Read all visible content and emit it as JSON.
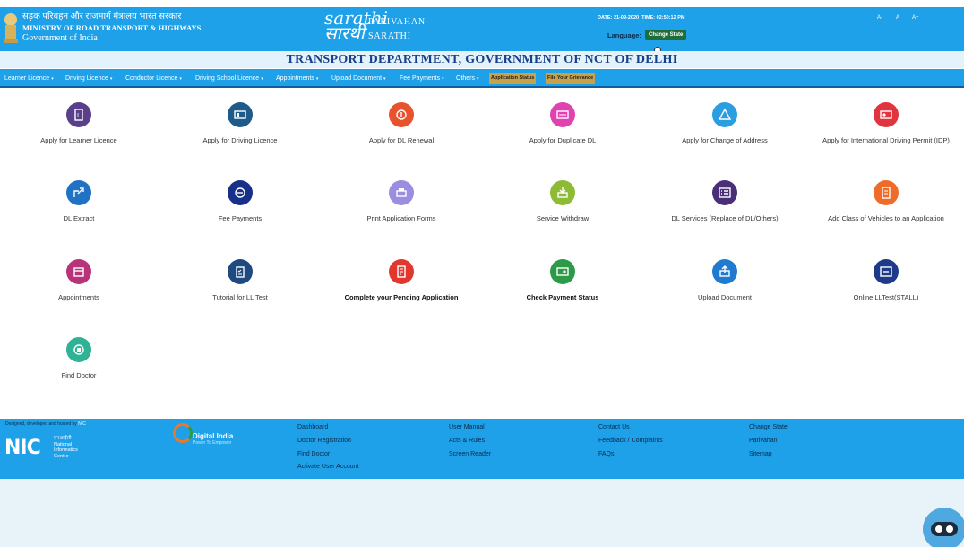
{
  "header": {
    "ministry_hindi": "सड़क परिवहन और राजमार्ग मंत्रालय भारत सरकार",
    "ministry_english": "MINISTRY OF ROAD TRANSPORT & HIGHWAYS",
    "government": "Government of India",
    "logo_mark": "sarathi",
    "logo_hindi": "सारथी",
    "logo_line1": "PARIVAHAN",
    "logo_line2": "SARATHI",
    "date_label": "DATE:",
    "date_value": "21-09-2020",
    "time_label": "TIME:",
    "time_value": "02:50:12 PM",
    "font_small": "A-",
    "font_normal": "A",
    "font_large": "A+",
    "language_label": "Language:",
    "change_state_label": "Change State"
  },
  "department_title": "TRANSPORT DEPARTMENT, GOVERNMENT OF NCT OF DELHI",
  "nav": {
    "items": [
      "Learner Licence",
      "Driving Licence",
      "Conductor Licence",
      "Driving School Licence",
      "Appointments",
      "Upload Document",
      "Fee Payments",
      "Others"
    ],
    "caret": "▾",
    "application_status": "Application Status",
    "file_grievance": "File Your Grievance"
  },
  "services": [
    {
      "label": "Apply for Learner Licence",
      "color": "#5a3f8a",
      "icon": "learner-licence-icon"
    },
    {
      "label": "Apply for Driving Licence",
      "color": "#1f5b8a",
      "icon": "driving-licence-icon"
    },
    {
      "label": "Apply for DL Renewal",
      "color": "#e8532e",
      "icon": "dl-renewal-icon"
    },
    {
      "label": "Apply for Duplicate DL",
      "color": "#e043b0",
      "icon": "duplicate-dl-icon"
    },
    {
      "label": "Apply for Change of Address",
      "color": "#2a9ee0",
      "icon": "change-address-icon"
    },
    {
      "label": "Apply for International Driving Permit (IDP)",
      "color": "#e0343f",
      "icon": "idp-icon"
    },
    {
      "label": "DL Extract",
      "color": "#1f72c4",
      "icon": "dl-extract-icon"
    },
    {
      "label": "Fee Payments",
      "color": "#17308a",
      "icon": "fee-payments-icon"
    },
    {
      "label": "Print Application Forms",
      "color": "#9b8ee0",
      "icon": "print-forms-icon"
    },
    {
      "label": "Service Withdraw",
      "color": "#8dbb35",
      "icon": "service-withdraw-icon"
    },
    {
      "label": "DL Services (Replace of DL/Others)",
      "color": "#4a2f78",
      "icon": "dl-services-icon"
    },
    {
      "label": "Add Class of Vehicles to an Application",
      "color": "#ee6b2a",
      "icon": "add-vehicle-class-icon"
    },
    {
      "label": "Appointments",
      "color": "#b8337a",
      "icon": "appointments-icon"
    },
    {
      "label": "Tutorial for LL Test",
      "color": "#1f4a80",
      "icon": "tutorial-icon"
    },
    {
      "label": "Complete your Pending Application",
      "color": "#e0382f",
      "icon": "pending-application-icon",
      "bold": true
    },
    {
      "label": "Check Payment Status",
      "color": "#2c9a46",
      "icon": "payment-status-icon",
      "bold": true
    },
    {
      "label": "Upload Document",
      "color": "#1f7ad0",
      "icon": "upload-document-icon"
    },
    {
      "label": "Online LLTest(STALL)",
      "color": "#1f3a8a",
      "icon": "online-lltest-icon"
    },
    {
      "label": "Find Doctor",
      "color": "#2fb394",
      "icon": "find-doctor-icon"
    }
  ],
  "footer": {
    "designed_by": "Designed, developed and hosted by",
    "nic_link": "NIC",
    "nic_logo": "NIC",
    "nic_hindi": "एनआईसी",
    "nic_line1": "National",
    "nic_line2": "Informatics",
    "nic_line3": "Centre",
    "digital_india": "Digital India",
    "digital_india_sub": "Power To Empower",
    "col1": [
      "Dashboard",
      "Doctor Registration",
      "Find Doctor",
      "Activate User Account"
    ],
    "col2": [
      "User Manual",
      "Acts & Rules",
      "Screen Reader"
    ],
    "col3": [
      "Contact Us",
      "Feedback / Complaints",
      "FAQs"
    ],
    "col4": [
      "Change State",
      "Parivahan",
      "Sitemap"
    ]
  }
}
